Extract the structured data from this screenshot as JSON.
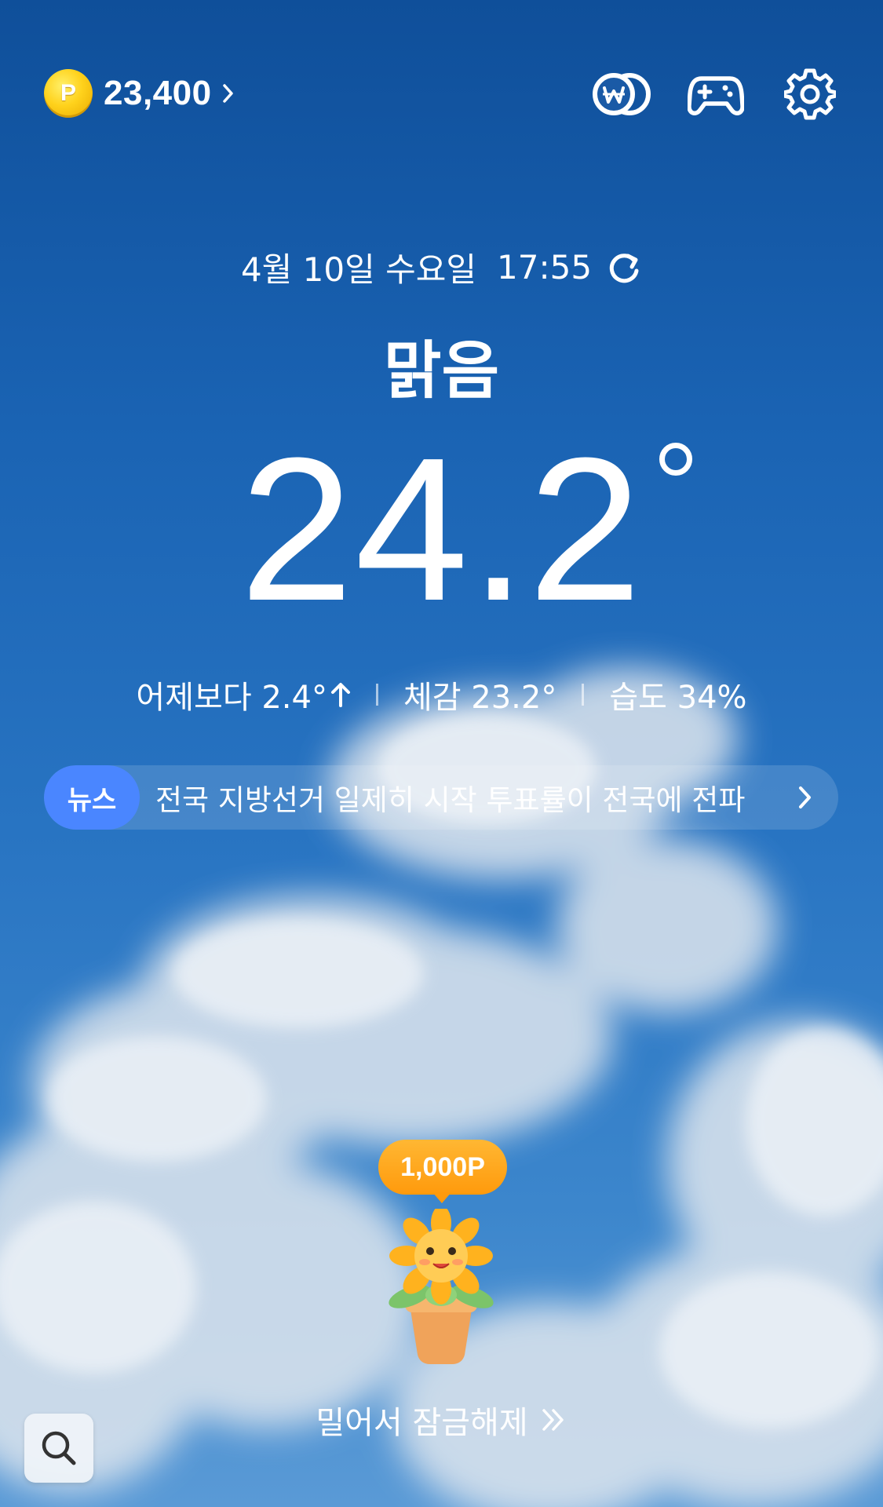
{
  "top_bar": {
    "coin_letter": "P",
    "points": "23,400",
    "icons": [
      "won-exchange-icon",
      "gamepad-icon",
      "gear-icon"
    ]
  },
  "weather": {
    "date": "4월 10일 수요일",
    "time": "17:55",
    "condition": "맑음",
    "temperature": "24.2",
    "vs_yesterday": "어제보다 2.4°",
    "feels_like": "체감 23.2°",
    "humidity": "습도 34%"
  },
  "news": {
    "badge": "뉴스",
    "headline": "전국 지방선거 일제히 시작 투표률이 전국에 전파"
  },
  "reward": {
    "points": "1,000P"
  },
  "unlock_label": "밀어서 잠금해제",
  "colors": {
    "news_badge": "#4a86ff",
    "reward_bubble": "#ff9a0c",
    "coin": "#ffd21c"
  }
}
